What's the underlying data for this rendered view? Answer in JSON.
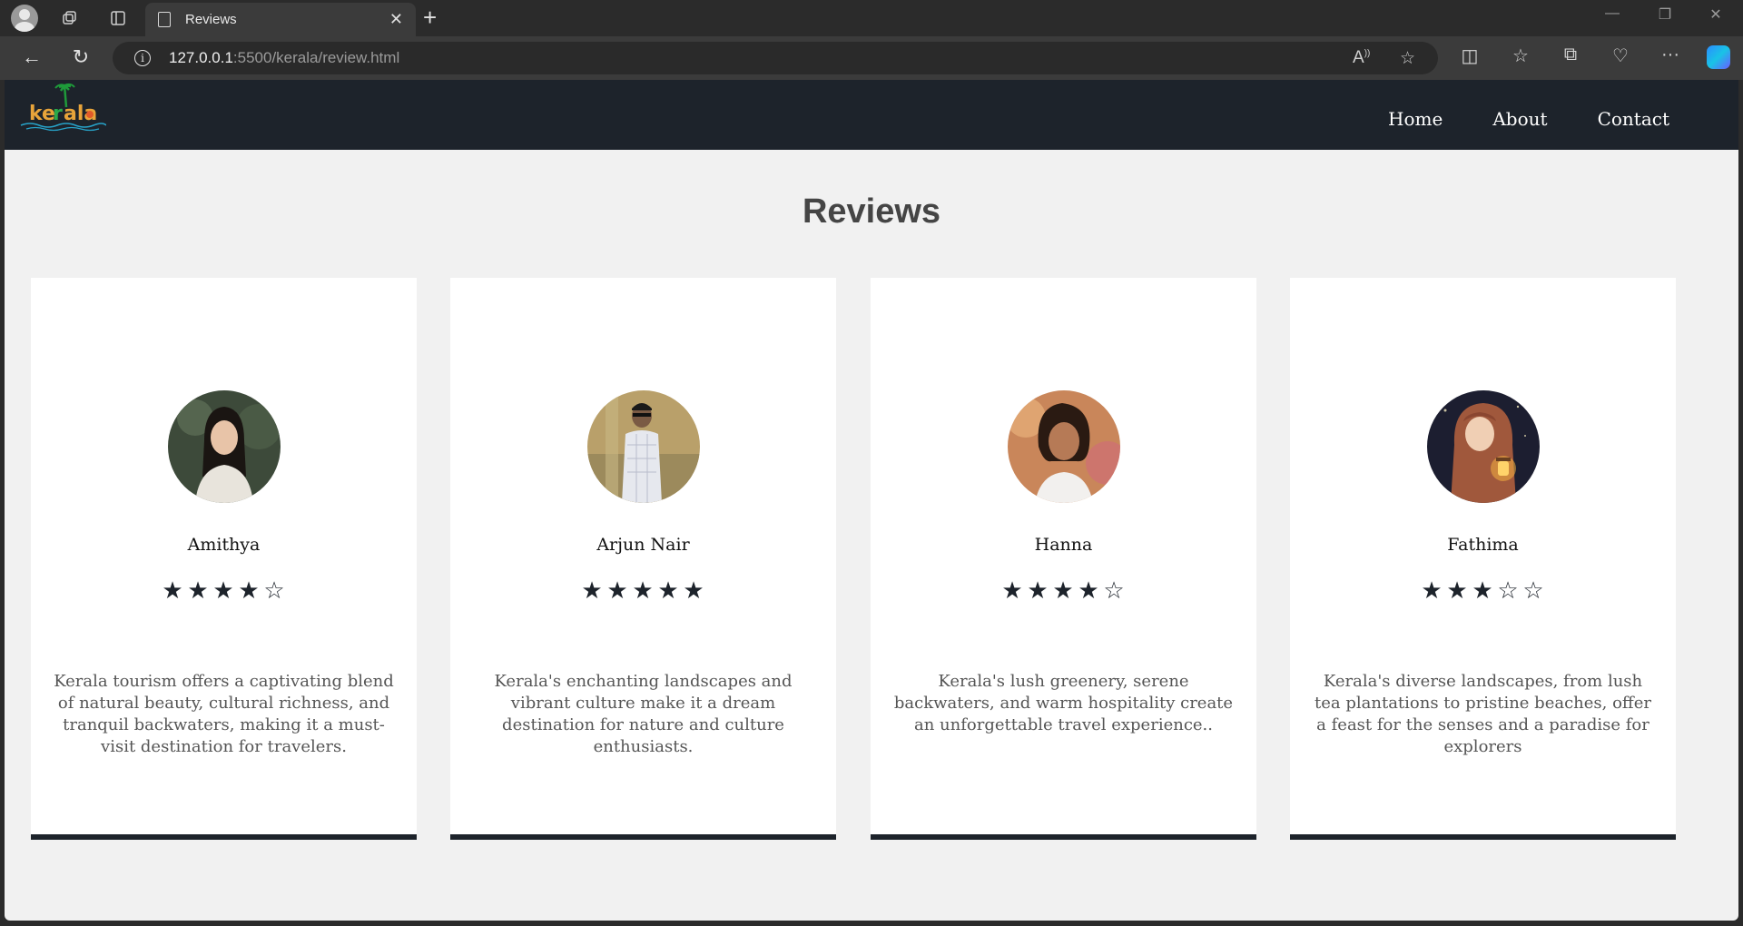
{
  "browser": {
    "tab_title": "Reviews",
    "url_host": "127.0.0.1",
    "url_rest": ":5500/kerala/review.html"
  },
  "site": {
    "logo_text": "kerala",
    "nav": [
      "Home",
      "About",
      "Contact"
    ]
  },
  "page": {
    "heading": "Reviews"
  },
  "reviews": [
    {
      "name": "Amithya",
      "rating": 4,
      "text": "Kerala tourism offers a captivating blend of natural beauty, cultural richness, and tranquil backwaters, making it a must-visit destination for travelers."
    },
    {
      "name": "Arjun Nair",
      "rating": 5,
      "text": "Kerala's enchanting landscapes and vibrant culture make it a dream destination for nature and culture enthusiasts."
    },
    {
      "name": "Hanna",
      "rating": 4,
      "text": "Kerala's lush greenery, serene backwaters, and warm hospitality create an unforgettable travel experience.."
    },
    {
      "name": "Fathima",
      "rating": 3,
      "text": "Kerala's diverse landscapes, from lush tea plantations to pristine beaches, offer a feast for the senses and a paradise for explorers"
    }
  ],
  "colors": {
    "navbar": "#1d232b",
    "page_bg": "#f1f1f1",
    "card_border": "#1d232b"
  }
}
